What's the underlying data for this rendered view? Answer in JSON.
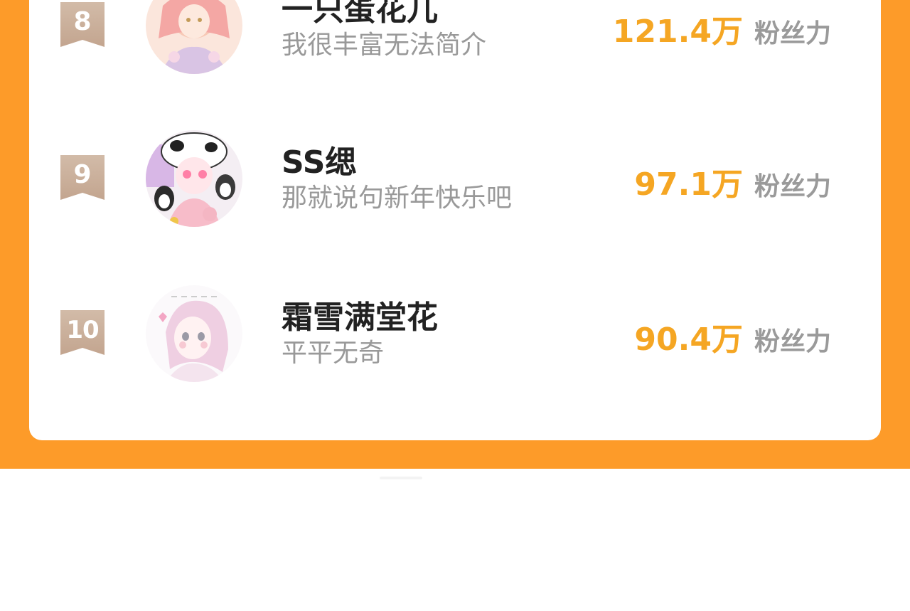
{
  "leaderboard": {
    "entries": [
      {
        "rank": "8",
        "name": "一只蛋花儿",
        "description": "我很丰富无法简介",
        "score": "121.4万",
        "score_unit": "粉丝力"
      },
      {
        "rank": "9",
        "name": "SS缌",
        "description": "那就说句新年快乐吧",
        "score": "97.1万",
        "score_unit": "粉丝力"
      },
      {
        "rank": "10",
        "name": "霜雪满堂花",
        "description": "平平无奇",
        "score": "90.4万",
        "score_unit": "粉丝力"
      }
    ]
  },
  "colors": {
    "frame": "#fd9b29",
    "card": "#ffffff",
    "score": "#f5a623",
    "badge": "#cdb4a2",
    "name": "#222222",
    "description": "#999999",
    "unit": "#9a9a9a"
  }
}
